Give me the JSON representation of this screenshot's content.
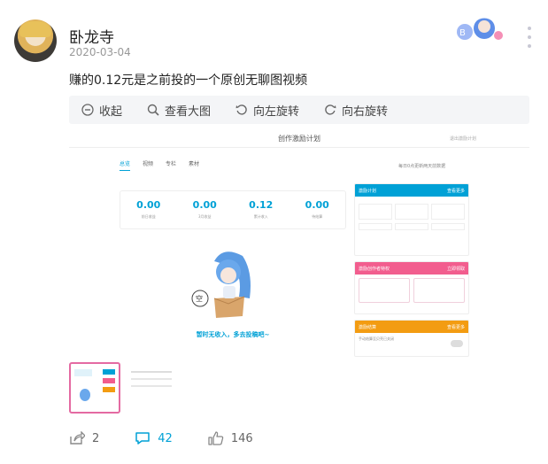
{
  "header": {
    "username": "卧龙寺",
    "date": "2020-03-04"
  },
  "post": {
    "text": "赚的0.12元是之前投的一个原创无聊图视频"
  },
  "toolbar": {
    "collapse_label": "收起",
    "view_large_label": "查看大图",
    "rotate_left_label": "向左旋转",
    "rotate_right_label": "向右旋转"
  },
  "screenshot": {
    "title": "创作激励计划",
    "exit_label": "退出激励计划",
    "tabs": [
      "总览",
      "视频",
      "专栏",
      "素材"
    ],
    "tabs_note": "每日0点更新两天前数据",
    "stats": [
      {
        "value": "0.00",
        "label": "前日收益"
      },
      {
        "value": "0.00",
        "label": "3月收益"
      },
      {
        "value": "0.12",
        "label": "累计收入"
      },
      {
        "value": "0.00",
        "label": "待结算"
      }
    ],
    "empty_text": "暂时无收入，多去投稿吧~",
    "panel_incentive": {
      "title": "激励计划",
      "more": "查看更多"
    },
    "panel_benefits": {
      "title": "激励创作者特权",
      "more": "立即领取"
    },
    "panel_settle": {
      "title": "激励结算",
      "more": "查看更多",
      "auto_settle": "手动结算至贝壳已关闭"
    }
  },
  "footer": {
    "share_count": "2",
    "comment_count": "42",
    "like_count": "146"
  },
  "icons": {
    "collapse": "collapse-icon",
    "zoom": "search-icon",
    "rotate_left": "rotate-left-icon",
    "rotate_right": "rotate-right-icon",
    "share": "share-icon",
    "comment": "comment-icon",
    "like": "thumb-up-icon",
    "more": "more-vertical-icon"
  },
  "colors": {
    "accent": "#00a1d6",
    "pink": "#f25d8e",
    "orange": "#f39c12"
  }
}
